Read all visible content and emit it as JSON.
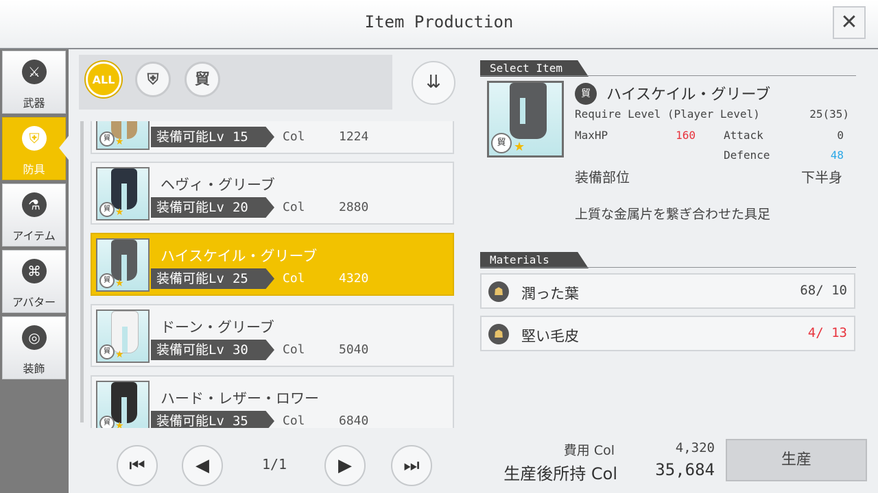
{
  "header": {
    "title": "Item Production",
    "close_label": "✕"
  },
  "sidebar": {
    "tabs": [
      {
        "label": "武器",
        "icon": "sword-icon",
        "glyph": "⚔",
        "active": false
      },
      {
        "label": "防具",
        "icon": "armor-icon",
        "glyph": "⛨",
        "active": true
      },
      {
        "label": "アイテム",
        "icon": "potion-icon",
        "glyph": "⚗",
        "active": false
      },
      {
        "label": "アバター",
        "icon": "coat-icon",
        "glyph": "⌘",
        "active": false
      },
      {
        "label": "装飾",
        "icon": "ring-icon",
        "glyph": "◎",
        "active": false
      }
    ]
  },
  "filters": {
    "all_label": "ALL",
    "chest_glyph": "⛨",
    "legs_glyph": "貿",
    "sort_glyph": "⇊"
  },
  "list": {
    "lv_label": "装備可能Lv",
    "col_label": "Col",
    "items": [
      {
        "name": "",
        "lv": "15",
        "col": "1224",
        "color": "#b99a6a",
        "selected": false
      },
      {
        "name": "ヘヴィ・グリーブ",
        "lv": "20",
        "col": "2880",
        "color": "#2c3440",
        "selected": false
      },
      {
        "name": "ハイスケイル・グリーブ",
        "lv": "25",
        "col": "4320",
        "color": "#5a5c5e",
        "selected": true
      },
      {
        "name": "ドーン・グリーブ",
        "lv": "30",
        "col": "5040",
        "color": "#f3f3f3",
        "selected": false
      },
      {
        "name": "ハード・レザー・ロワー",
        "lv": "35",
        "col": "6840",
        "color": "#2e2e2e",
        "selected": false
      }
    ]
  },
  "pager": {
    "first": "⏮",
    "prev": "◀",
    "next": "▶",
    "last": "⏭",
    "page": "1/1"
  },
  "select_item": {
    "section_label": "Select Item",
    "name": "ハイスケイル・グリーブ",
    "require_label": "Require Level (Player Level)",
    "require_value": "25(35)",
    "maxhp_label": "MaxHP",
    "maxhp_value": "160",
    "attack_label": "Attack",
    "attack_value": "0",
    "defence_label": "Defence",
    "defence_value": "48",
    "slot_label": "装備部位",
    "slot_value": "下半身",
    "description": "上質な金属片を繋ぎ合わせた具足"
  },
  "materials": {
    "section_label": "Materials",
    "items": [
      {
        "name": "潤った葉",
        "count": "68/ 10",
        "enough": true
      },
      {
        "name": "堅い毛皮",
        "count": "4/ 13",
        "enough": false
      }
    ]
  },
  "footer": {
    "cost_label": "費用 Col",
    "cost_value": "4,320",
    "after_label": "生産後所持 Col",
    "after_value": "35,684",
    "produce_label": "生産"
  },
  "colors": {
    "accent": "#f2c200",
    "red": "#e8323c",
    "blue": "#2aa7e6"
  }
}
